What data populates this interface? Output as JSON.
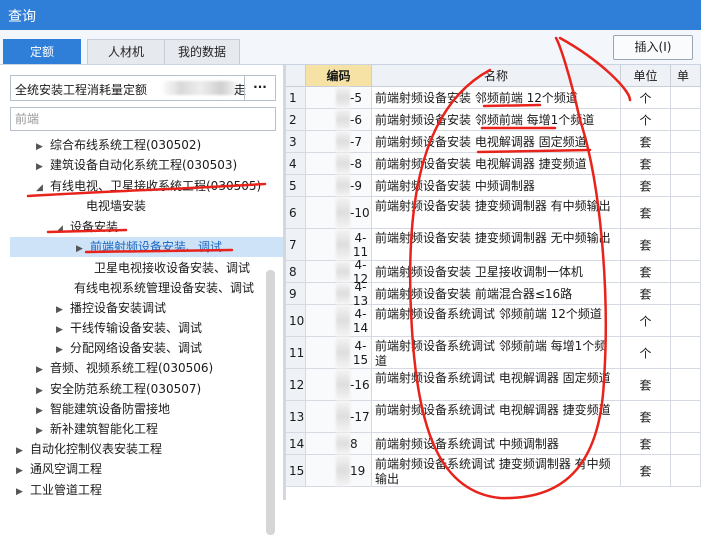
{
  "window": {
    "title": "查询"
  },
  "tabs": [
    {
      "label": "定额",
      "active": true
    },
    {
      "label": "人材机",
      "active": false
    },
    {
      "label": "我的数据",
      "active": false
    }
  ],
  "toolbar": {
    "insert_label": "插入(I)"
  },
  "left": {
    "library_value": "全统安装工程消耗量定额",
    "library_value_tail": "走",
    "library_dots": "···",
    "search_placeholder": "前端",
    "tree": [
      {
        "label": "综合布线系统工程(030502)",
        "arrow": "▶"
      },
      {
        "label": "建筑设备自动化系统工程(030503)",
        "arrow": "▶"
      },
      {
        "label": "有线电视、卫星接收系统工程(030505)",
        "arrow": "◢"
      },
      {
        "label": "电视墙安装",
        "arrow": ""
      },
      {
        "label": "设备安装",
        "arrow": "◢"
      },
      {
        "label": "前端射频设备安装、调试",
        "arrow": "▶"
      },
      {
        "label": "卫星电视接收设备安装、调试",
        "arrow": ""
      },
      {
        "label": "有线电视系统管理设备安装、调试",
        "arrow": ""
      },
      {
        "label": "播控设备安装调试",
        "arrow": "▶"
      },
      {
        "label": "干线传输设备安装、调试",
        "arrow": "▶"
      },
      {
        "label": "分配网络设备安装、调试",
        "arrow": "▶"
      },
      {
        "label": "音频、视频系统工程(030506)",
        "arrow": "▶"
      },
      {
        "label": "安全防范系统工程(030507)",
        "arrow": "▶"
      },
      {
        "label": "智能建筑设备防雷接地",
        "arrow": "▶"
      },
      {
        "label": "新补建筑智能化工程",
        "arrow": "▶"
      },
      {
        "label": "自动化控制仪表安装工程",
        "arrow": "▶"
      },
      {
        "label": "通风空调工程",
        "arrow": "▶"
      },
      {
        "label": "工业管道工程",
        "arrow": "▶"
      }
    ]
  },
  "grid": {
    "headers": [
      "编码",
      "名称",
      "单位",
      "单"
    ],
    "rows": [
      {
        "idx": "1",
        "code": "-5",
        "name": "前端射频设备安装 邻频前端 12个频道",
        "unit": "个"
      },
      {
        "idx": "2",
        "code": "-6",
        "name": "前端射频设备安装 邻频前端 每增1个频道",
        "unit": "个"
      },
      {
        "idx": "3",
        "code": "-7",
        "name": "前端射频设备安装 电视解调器 固定频道",
        "unit": "套"
      },
      {
        "idx": "4",
        "code": "-8",
        "name": "前端射频设备安装 电视解调器 捷变频道",
        "unit": "套"
      },
      {
        "idx": "5",
        "code": "-9",
        "name": "前端射频设备安装 中频调制器",
        "unit": "套"
      },
      {
        "idx": "6",
        "code": "-10",
        "name": "前端射频设备安装 捷变频调制器 有中频输出",
        "unit": "套"
      },
      {
        "idx": "7",
        "code": "4-11",
        "name": "前端射频设备安装 捷变频调制器 无中频输出",
        "unit": "套"
      },
      {
        "idx": "8",
        "code": "4-12",
        "name": "前端射频设备安装 卫星接收调制一体机",
        "unit": "套"
      },
      {
        "idx": "9",
        "code": "4-13",
        "name": "前端射频设备安装 前端混合器≤16路",
        "unit": "套"
      },
      {
        "idx": "10",
        "code": "4-14",
        "name": "前端射频设备系统调试 邻频前端 12个频道",
        "unit": "个"
      },
      {
        "idx": "11",
        "code": "4-15",
        "name": "前端射频设备系统调试 邻频前端 每增1个频道",
        "unit": "个"
      },
      {
        "idx": "12",
        "code": "-16",
        "name": "前端射频设备系统调试 电视解调器 固定频道",
        "unit": "套"
      },
      {
        "idx": "13",
        "code": "-17",
        "name": "前端射频设备系统调试 电视解调器 捷变频道",
        "unit": "套"
      },
      {
        "idx": "14",
        "code": "8",
        "name": "前端射频设备系统调试 中频调制器",
        "unit": "套"
      },
      {
        "idx": "15",
        "code": "19",
        "name": "前端射频设备系统调试 捷变频调制器 有中频输出",
        "unit": "套"
      }
    ]
  },
  "annotation_color": "#e8231b"
}
